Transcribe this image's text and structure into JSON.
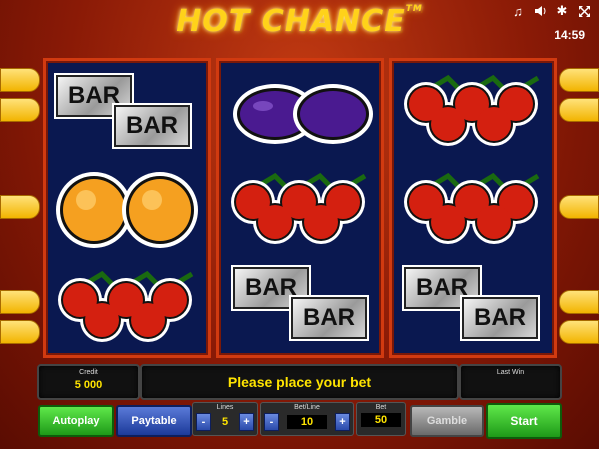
{
  "title": "HOT CHANCE",
  "trademark": "TM",
  "clock": "14:59",
  "top_icons": [
    "music-icon",
    "sound-icon",
    "settings-icon",
    "fullscreen-icon"
  ],
  "reels": [
    [
      "bar",
      "orange",
      "cherry"
    ],
    [
      "plum",
      "cherry",
      "bar"
    ],
    [
      "cherry",
      "cherry",
      "bar"
    ]
  ],
  "bar_label": "BAR",
  "credit": {
    "label": "Credit",
    "value": "5 000"
  },
  "message": "Please place your bet",
  "last_win": {
    "label": "Last Win",
    "value": ""
  },
  "buttons": {
    "autoplay": "Autoplay",
    "paytable": "Paytable",
    "gamble": "Gamble",
    "start": "Start"
  },
  "lines": {
    "label": "Lines",
    "value": "5",
    "minus": "-",
    "plus": "+"
  },
  "bet_line": {
    "label": "Bet/Line",
    "value": "10",
    "minus": "-",
    "plus": "+"
  },
  "bet": {
    "label": "Bet",
    "value": "50"
  },
  "colors": {
    "reel_bg": "#0a1850",
    "frame": "#d13a10",
    "accent": "#ffe400"
  }
}
